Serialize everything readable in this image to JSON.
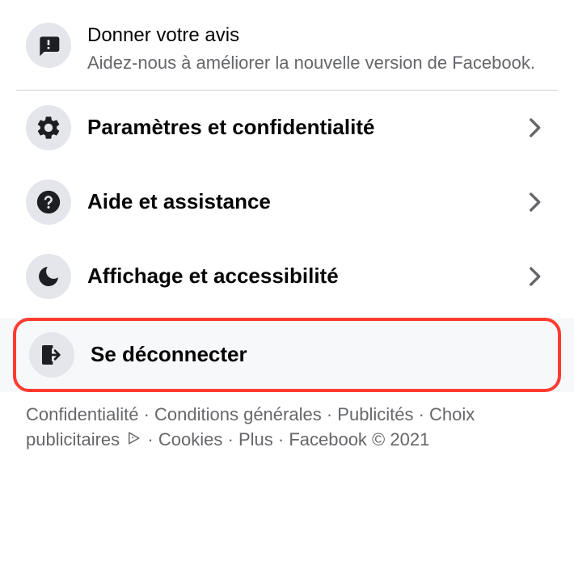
{
  "feedback": {
    "title": "Donner votre avis",
    "subtitle": "Aidez-nous à améliorer la nouvelle version de Facebook."
  },
  "menu": {
    "settings_privacy": "Paramètres et confidentialité",
    "help_support": "Aide et assistance",
    "display_accessibility": "Affichage et accessibilité",
    "logout": "Se déconnecter"
  },
  "footer": {
    "confidentialite": "Confidentialité",
    "conditions": "Conditions générales",
    "publicites": "Publicités",
    "choix": "Choix publicitaires",
    "cookies": "Cookies",
    "plus": "Plus",
    "copyright": "Facebook © 2021"
  }
}
